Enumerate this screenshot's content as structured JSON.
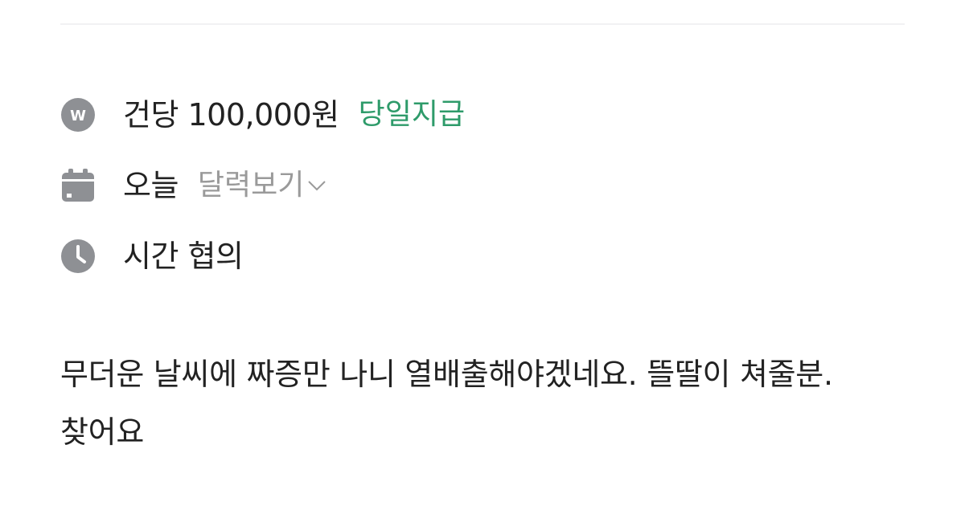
{
  "pay": {
    "icon": "won-coin-icon",
    "amount_text": "건당 100,000원",
    "payment_timing": "당일지급",
    "accent_color": "#2e9b6a"
  },
  "date": {
    "icon": "calendar-icon",
    "value": "오늘",
    "calendar_link_label": "달력보기"
  },
  "time": {
    "icon": "clock-icon",
    "value": "시간 협의"
  },
  "description": {
    "text": "무더운 날씨에 짜증만 나니  열배출해야겠네요. 뜰딸이 쳐줄분. 찾어요"
  }
}
